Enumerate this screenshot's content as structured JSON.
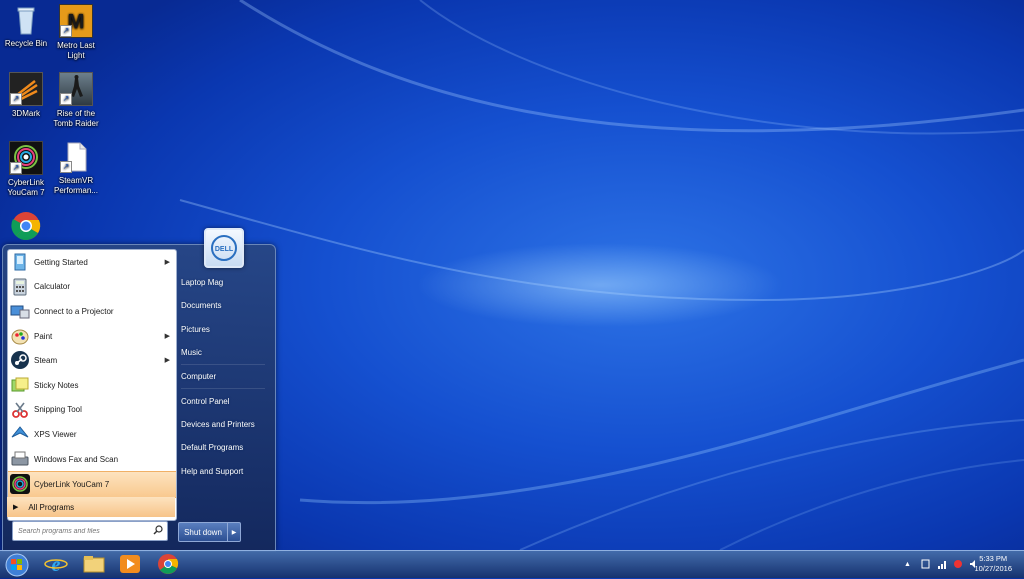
{
  "desktop": {
    "icons": [
      {
        "label": "Recycle Bin",
        "icon": "recycle-bin-icon"
      },
      {
        "label": "Metro Last Light",
        "icon": "metro-last-light-icon"
      },
      {
        "label": "3DMark",
        "icon": "3dmark-icon"
      },
      {
        "label": "Rise of the Tomb Raider",
        "icon": "tomb-raider-icon"
      },
      {
        "label": "CyberLink YouCam 7",
        "icon": "youcam-icon"
      },
      {
        "label": "SteamVR Performan...",
        "icon": "steamvr-file-icon"
      },
      {
        "label": "",
        "icon": "chrome-icon"
      }
    ]
  },
  "start_menu": {
    "programs": [
      {
        "label": "Getting Started",
        "icon": "getting-started-icon",
        "has_submenu": true
      },
      {
        "label": "Calculator",
        "icon": "calculator-icon",
        "has_submenu": false
      },
      {
        "label": "Connect to a Projector",
        "icon": "projector-icon",
        "has_submenu": false
      },
      {
        "label": "Paint",
        "icon": "paint-icon",
        "has_submenu": true
      },
      {
        "label": "Steam",
        "icon": "steam-icon",
        "has_submenu": true
      },
      {
        "label": "Sticky Notes",
        "icon": "sticky-notes-icon",
        "has_submenu": false
      },
      {
        "label": "Snipping Tool",
        "icon": "snipping-tool-icon",
        "has_submenu": false
      },
      {
        "label": "XPS Viewer",
        "icon": "xps-viewer-icon",
        "has_submenu": false
      },
      {
        "label": "Windows Fax and Scan",
        "icon": "fax-scan-icon",
        "has_submenu": false
      },
      {
        "label": "CyberLink YouCam 7",
        "icon": "youcam-icon",
        "has_submenu": false,
        "highlighted": true
      }
    ],
    "all_programs_label": "All Programs",
    "search_placeholder": "Search programs and files",
    "right_items": [
      "Laptop Mag",
      "Documents",
      "Pictures",
      "Music",
      "Computer",
      "Control Panel",
      "Devices and Printers",
      "Default Programs",
      "Help and Support"
    ],
    "shutdown_label": "Shut down",
    "user_picture_text": "DELL"
  },
  "taskbar": {
    "pinned": [
      "start-orb-icon",
      "internet-explorer-icon",
      "file-explorer-icon",
      "media-player-icon",
      "chrome-icon"
    ],
    "clock_time": "5:33 PM",
    "clock_date": "10/27/2016"
  }
}
